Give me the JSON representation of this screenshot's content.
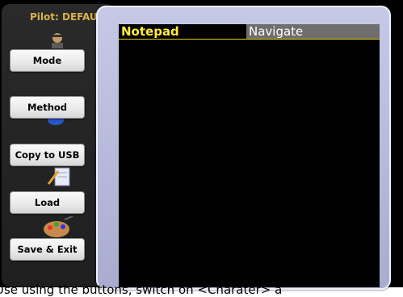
{
  "header": {
    "pilot_label": "Pilot: DEFAULT"
  },
  "sidebar": {
    "buttons": [
      {
        "label": "Mode"
      },
      {
        "label": "Method"
      },
      {
        "label": "Copy to USB"
      },
      {
        "label": "Load"
      },
      {
        "label": "Save & Exit"
      }
    ]
  },
  "notepad": {
    "tabs": [
      {
        "label": "Notepad",
        "active": true
      },
      {
        "label": "Navigate",
        "active": false
      }
    ]
  },
  "status_bar": {
    "text": "Use using the buttons, switch on <Charater> a"
  },
  "colors": {
    "accent_yellow": "#ffeb3b",
    "pilot_text": "#d8b248",
    "dialog_frame": "#b8bbdd",
    "inactive_tab": "#6e6e6e"
  }
}
